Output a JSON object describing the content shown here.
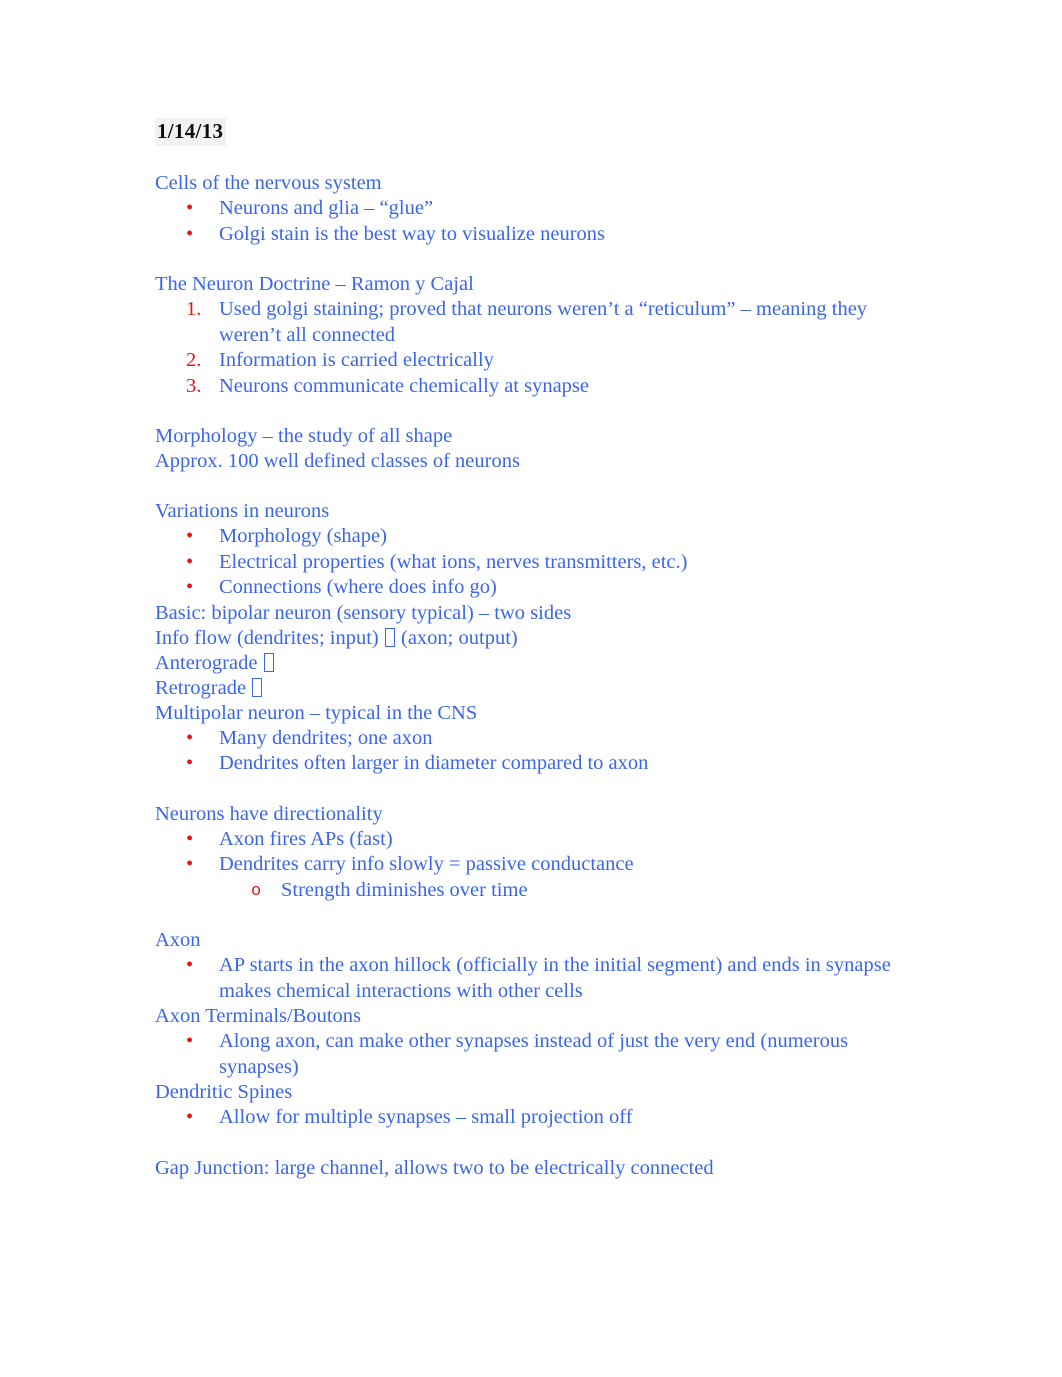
{
  "document": {
    "date_heading": "1/14/13",
    "text_color": "#3b66e8",
    "marker_color": "#ee1111",
    "heading_color": "#0d0d0d",
    "highlight_color": "#f2f2f2"
  },
  "sections": {
    "cells": {
      "heading": "Cells of the nervous system",
      "bullets": [
        "Neurons and glia – “glue”",
        "Golgi stain is the best way to visualize neurons"
      ]
    },
    "neuron_doctrine": {
      "heading": "The Neuron Doctrine – Ramon y Cajal",
      "items": [
        {
          "number": "1.",
          "text": "Used golgi staining; proved that neurons weren’t a “reticulum” – meaning they weren’t all connected"
        },
        {
          "number": "2.",
          "text": "Information is carried electrically"
        },
        {
          "number": "3.",
          "text": "Neurons communicate chemically at synapse"
        }
      ]
    },
    "morphology": {
      "line1": "Morphology – the study of all shape",
      "line2": "Approx. 100 well defined classes of neurons"
    },
    "variations": {
      "heading": "Variations in neurons",
      "bullets": [
        "Morphology (shape)",
        "Electrical properties (what ions, nerves transmitters, etc.)",
        "Connections (where does info go)"
      ],
      "after_lines": {
        "basic": "Basic: bipolar neuron (sensory typical) – two sides",
        "info_flow_before": "Info flow (dendrites; input) ",
        "info_flow_after": " (axon; output)",
        "anterograde": "Anterograde ",
        "retrograde": "Retrograde ",
        "multipolar": "Multipolar neuron – typical in the CNS"
      },
      "multipolar_bullets": [
        "Many dendrites; one axon",
        "Dendrites often larger in diameter compared to axon"
      ]
    },
    "directionality": {
      "heading": "Neurons have directionality",
      "bullets": [
        "Axon fires APs (fast)",
        "Dendrites carry info slowly = passive conductance"
      ],
      "sub_bullet_marker": "o",
      "sub_bullets": [
        "Strength diminishes over time"
      ]
    },
    "axon": {
      "heading": "Axon",
      "bullets": [
        "AP starts in the axon hillock (officially in the initial segment) and ends in synapse makes chemical interactions with other cells"
      ]
    },
    "axon_terminals": {
      "heading": "Axon Terminals/Boutons",
      "bullets": [
        "Along axon, can make other synapses instead of just the very end (numerous synapses)"
      ]
    },
    "dendritic_spines": {
      "heading": "Dendritic Spines",
      "bullets": [
        "Allow for multiple synapses – small projection off"
      ]
    },
    "gap_junction": {
      "line": "Gap Junction: large channel, allows two to be electrically connected"
    }
  }
}
